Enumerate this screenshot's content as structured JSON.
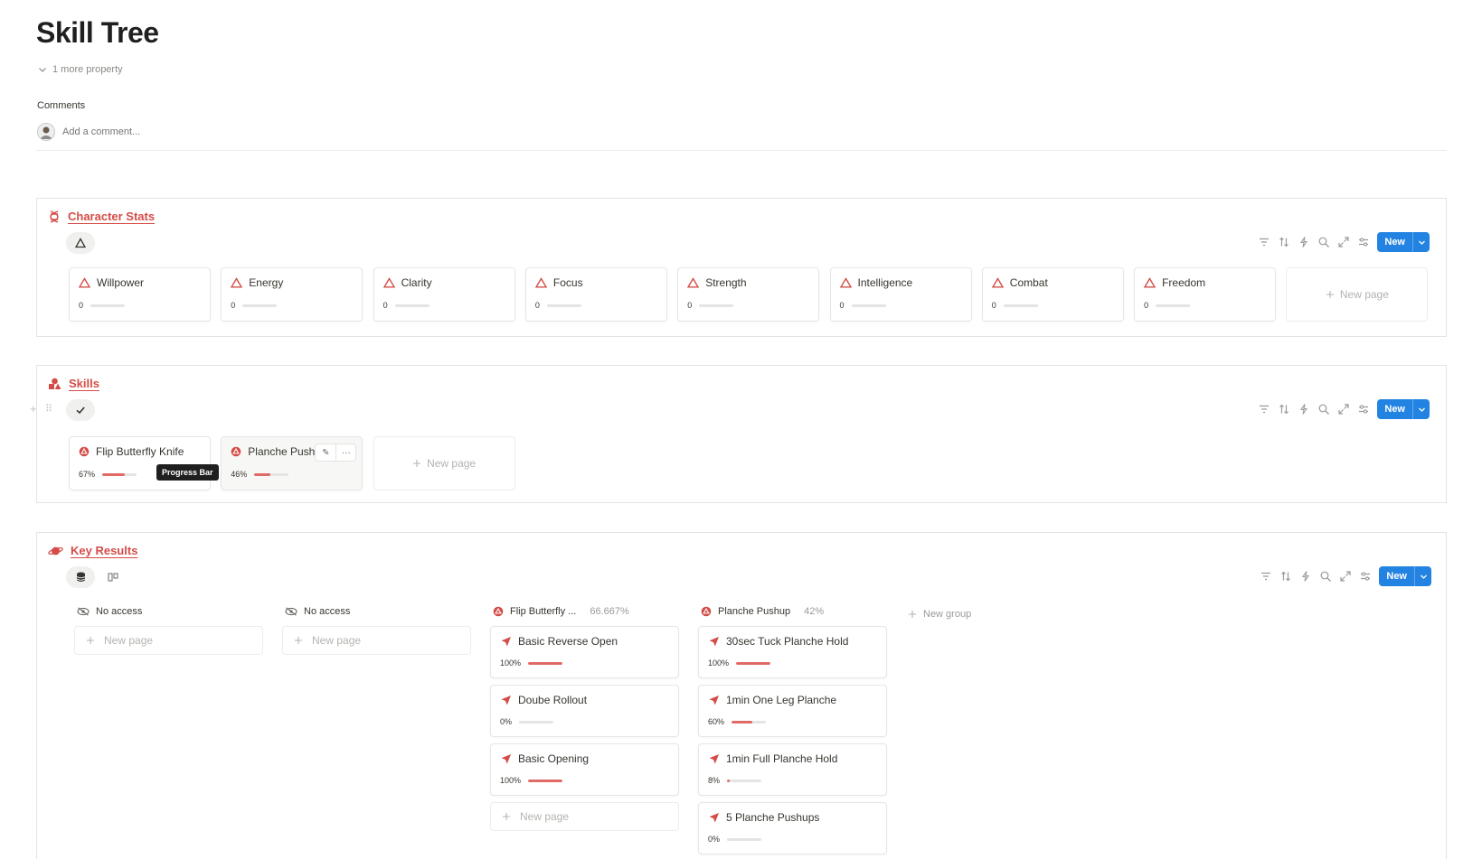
{
  "page": {
    "title": "Skill Tree",
    "more_property": "1 more property",
    "comments_label": "Comments",
    "comment_placeholder": "Add a comment..."
  },
  "colors": {
    "accent": "#d44c47",
    "primary_button": "#2383e2",
    "progress_fill": "#e06b66"
  },
  "toolbar": {
    "new_label": "New",
    "icons": [
      "filter-icon",
      "sort-icon",
      "automation-icon",
      "search-icon",
      "expand-icon",
      "settings-icon"
    ]
  },
  "character_stats": {
    "title": "Character Stats",
    "icon": "dna-icon",
    "view_icon": "triangle-icon",
    "cards": [
      {
        "name": "Willpower",
        "value": "0",
        "progress": 0
      },
      {
        "name": "Energy",
        "value": "0",
        "progress": 0
      },
      {
        "name": "Clarity",
        "value": "0",
        "progress": 0
      },
      {
        "name": "Focus",
        "value": "0",
        "progress": 0
      },
      {
        "name": "Strength",
        "value": "0",
        "progress": 0
      },
      {
        "name": "Intelligence",
        "value": "0",
        "progress": 0
      },
      {
        "name": "Combat",
        "value": "0",
        "progress": 0
      },
      {
        "name": "Freedom",
        "value": "0",
        "progress": 0
      }
    ],
    "new_page": "New page"
  },
  "skills": {
    "title": "Skills",
    "icon": "shapes-icon",
    "view_icon": "check-icon",
    "cards": [
      {
        "name": "Flip Butterfly Knife",
        "value": "67%",
        "progress": 0.67
      },
      {
        "name": "Planche Push",
        "value": "46%",
        "progress": 0.46
      }
    ],
    "tooltip": "Progress Bar",
    "new_page": "New page"
  },
  "key_results": {
    "title": "Key Results",
    "icon": "planet-icon",
    "groups": [
      {
        "name": "No access",
        "count": "",
        "icon": "eye-off-icon",
        "cards": [],
        "new_page": "New page"
      },
      {
        "name": "No access",
        "count": "",
        "icon": "eye-off-icon",
        "cards": [],
        "new_page": "New page"
      },
      {
        "name": "Flip Butterfly ...",
        "count": "66.667%",
        "icon": "skill-icon",
        "cards": [
          {
            "name": "Basic Reverse Open",
            "value": "100%",
            "progress": 1.0
          },
          {
            "name": "Doube Rollout",
            "value": "0%",
            "progress": 0
          },
          {
            "name": "Basic Opening",
            "value": "100%",
            "progress": 1.0
          }
        ],
        "new_page": "New page"
      },
      {
        "name": "Planche Pushup",
        "count": "42%",
        "icon": "skill-icon",
        "cards": [
          {
            "name": "30sec Tuck Planche Hold",
            "value": "100%",
            "progress": 1.0
          },
          {
            "name": "1min One Leg Planche",
            "value": "60%",
            "progress": 0.6
          },
          {
            "name": "1min Full Planche Hold",
            "value": "8%",
            "progress": 0.08
          },
          {
            "name": "5 Planche Pushups",
            "value": "0%",
            "progress": 0
          }
        ],
        "new_page": ""
      }
    ],
    "new_group": "New group"
  }
}
